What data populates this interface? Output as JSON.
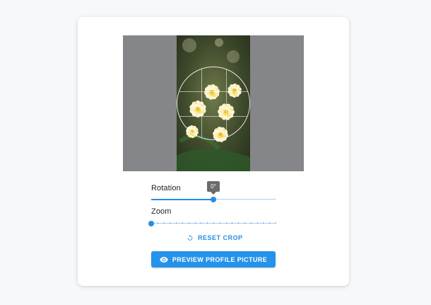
{
  "cropper": {
    "image_alt": "Plumeria flowers"
  },
  "rotation": {
    "label": "Rotation",
    "tooltip": "0°",
    "value_fraction": 0.5
  },
  "zoom": {
    "label": "Zoom",
    "value_fraction": 0.0
  },
  "reset_button": {
    "label": "RESET CROP",
    "icon": "reset-icon"
  },
  "preview_button": {
    "label": "PREVIEW PROFILE PICTURE",
    "icon": "eye-icon"
  },
  "colors": {
    "accent": "#2593ea",
    "crop_overlay": "#858689"
  }
}
